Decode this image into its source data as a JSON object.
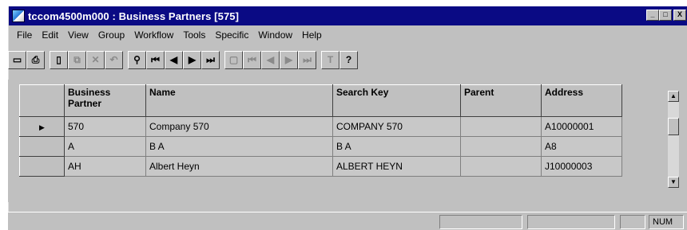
{
  "window": {
    "title": "tccom4500m000 : Business Partners [575]",
    "title_buttons": [
      "_",
      "□",
      "X"
    ]
  },
  "menu": [
    "File",
    "Edit",
    "View",
    "Group",
    "Workflow",
    "Tools",
    "Specific",
    "Window",
    "Help"
  ],
  "toolbar": {
    "groups": [
      [
        {
          "name": "save-icon",
          "glyph": "▭",
          "disabled": false
        },
        {
          "name": "print-icon",
          "glyph": "⎙",
          "disabled": false
        }
      ],
      [
        {
          "name": "new-icon",
          "glyph": "▯",
          "disabled": false
        },
        {
          "name": "copy-icon",
          "glyph": "⧉",
          "disabled": true
        },
        {
          "name": "delete-icon",
          "glyph": "✕",
          "disabled": true
        },
        {
          "name": "undo-icon",
          "glyph": "↶",
          "disabled": true
        }
      ],
      [
        {
          "name": "find-icon",
          "glyph": "⚲",
          "disabled": false
        },
        {
          "name": "first-record-icon",
          "glyph": "⏮",
          "disabled": false
        },
        {
          "name": "previous-record-icon",
          "glyph": "◀",
          "disabled": false
        },
        {
          "name": "next-record-icon",
          "glyph": "▶",
          "disabled": false
        },
        {
          "name": "last-record-icon",
          "glyph": "⏭",
          "disabled": false
        }
      ],
      [
        {
          "name": "form-icon",
          "glyph": "▢",
          "disabled": true
        },
        {
          "name": "first-group-icon",
          "glyph": "⏮",
          "disabled": true
        },
        {
          "name": "previous-group-icon",
          "glyph": "◀",
          "disabled": true
        },
        {
          "name": "next-group-icon",
          "glyph": "▶",
          "disabled": true
        },
        {
          "name": "last-group-icon",
          "glyph": "⏭",
          "disabled": true
        }
      ],
      [
        {
          "name": "text-icon",
          "glyph": "T",
          "disabled": true
        },
        {
          "name": "context-help-icon",
          "glyph": "?",
          "disabled": false
        }
      ]
    ]
  },
  "grid": {
    "columns": [
      "Business Partner",
      "Name",
      "Search Key",
      "Parent",
      "Address"
    ],
    "rows": [
      {
        "current": true,
        "cells": [
          "570",
          "Company 570",
          "COMPANY 570",
          "",
          "A10000001"
        ]
      },
      {
        "current": false,
        "cells": [
          "A",
          "B A",
          "B A",
          "",
          "A8"
        ]
      },
      {
        "current": false,
        "cells": [
          "AH",
          "Albert Heyn",
          "ALBERT HEYN",
          "",
          "J10000003"
        ]
      }
    ]
  },
  "statusbar": {
    "num": "NUM"
  }
}
